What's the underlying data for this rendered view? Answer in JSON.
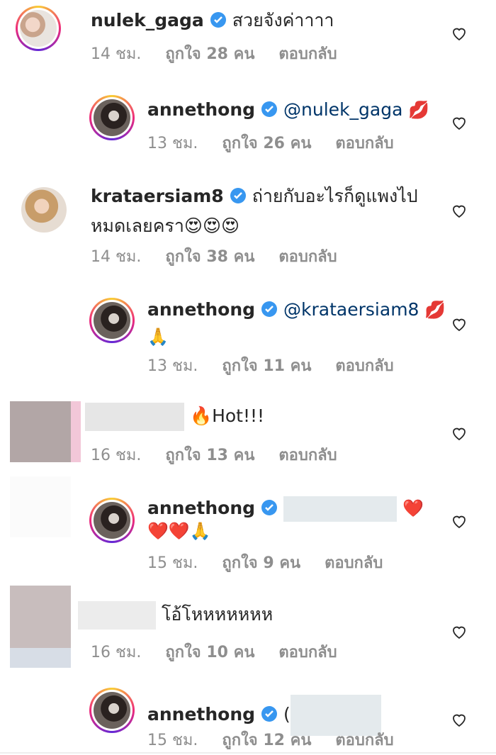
{
  "comments": [
    {
      "user": "nulek_gaga",
      "text": "สวยจังค่าาาา",
      "time": "14 ชม.",
      "likes": "ถูกใจ 28 คน",
      "reply": "ตอบกลับ"
    },
    {
      "user": "annethong",
      "mention": "@nulek_gaga",
      "text": "💋",
      "time": "13 ชม.",
      "likes": "ถูกใจ 26 คน",
      "reply": "ตอบกลับ"
    },
    {
      "user": "krataersiam8",
      "text": "ถ่ายกับอะไรก็ดูแพงไป",
      "text2": "หมดเลยครา😍😍😍",
      "time": "14 ชม.",
      "likes": "ถูกใจ 38 คน",
      "reply": "ตอบกลับ"
    },
    {
      "user": "annethong",
      "mention": "@krataersiam8",
      "text": "💋",
      "text2": "🙏",
      "time": "13 ชม.",
      "likes": "ถูกใจ 11 คน",
      "reply": "ตอบกลับ"
    },
    {
      "user": "",
      "text": "🔥Hot!!!",
      "time": "16 ชม.",
      "likes": "ถูกใจ 13 คน",
      "reply": "ตอบกลับ"
    },
    {
      "user": "annethong",
      "text": "❤️",
      "text2": "❤️❤️🙏",
      "time": "15 ชม.",
      "likes": "ถูกใจ 9 คน",
      "reply": "ตอบกลับ"
    },
    {
      "user": "",
      "text": "โอ้โหหหหหหห",
      "time": "16 ชม.",
      "likes": "ถูกใจ 10 คน",
      "reply": "ตอบกลับ"
    },
    {
      "user": "annethong",
      "text": "(",
      "time": "15 ชม.",
      "likes": "ถูกใจ 12 คน",
      "reply": "ตอบกลับ"
    }
  ]
}
